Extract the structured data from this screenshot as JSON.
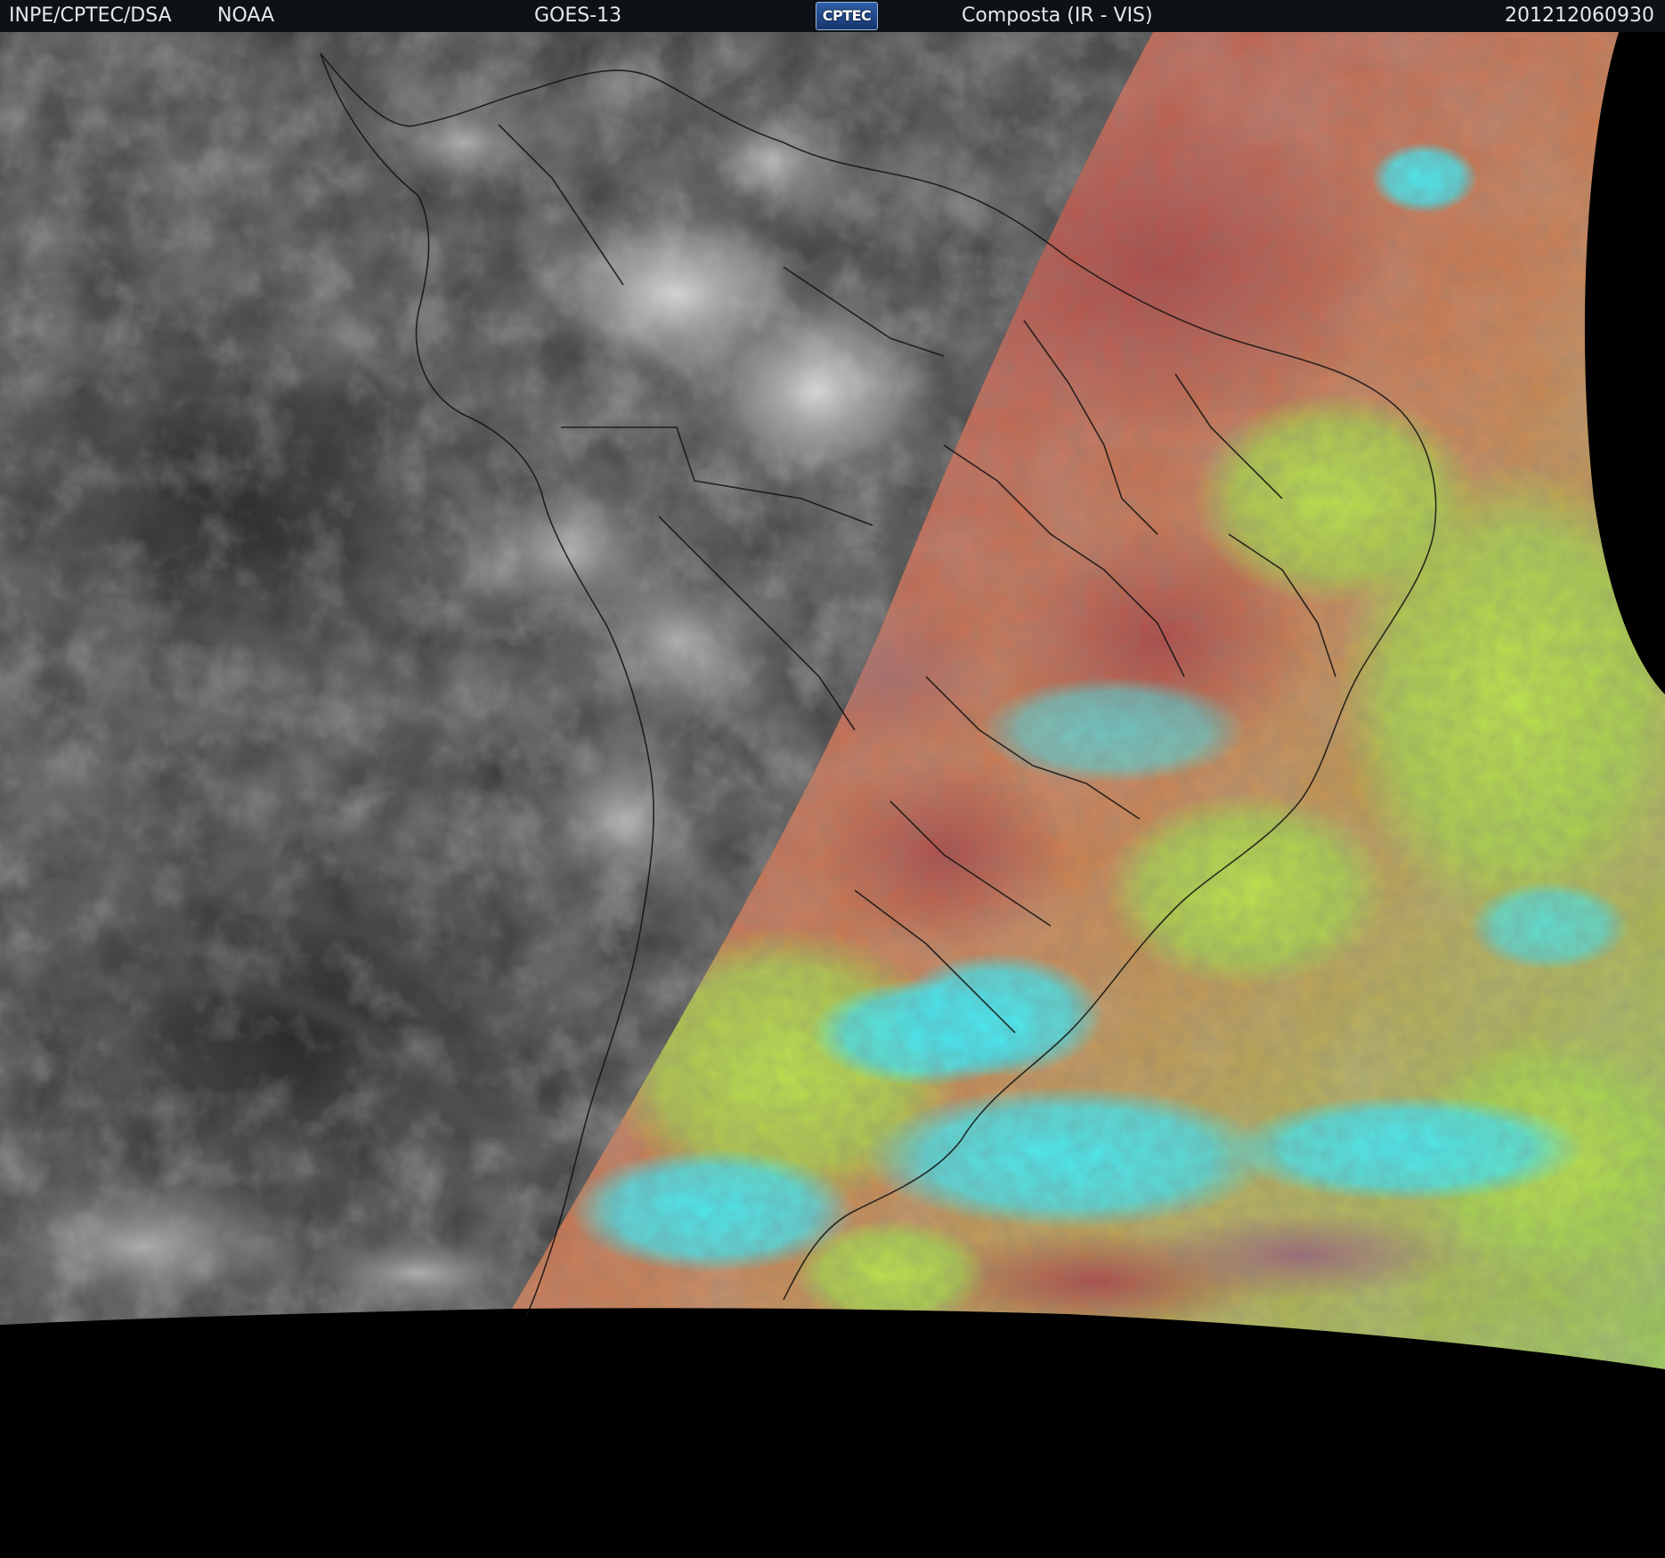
{
  "header": {
    "institution": "INPE/CPTEC/DSA",
    "agency": "NOAA",
    "satellite": "GOES-13",
    "logo_text": "CPTEC",
    "product": "Composta (IR - VIS)",
    "timestamp": "201212060930"
  },
  "colors": {
    "header_background": "#0d1216",
    "ir_gray": "#3a3a3a",
    "vis_red": "#b4504a",
    "vis_orange": "#d27c46",
    "vis_yellow_green": "#b4dc4a",
    "vis_cyan": "#46e6f0",
    "coastline": "#111111",
    "space_background": "#000000"
  }
}
